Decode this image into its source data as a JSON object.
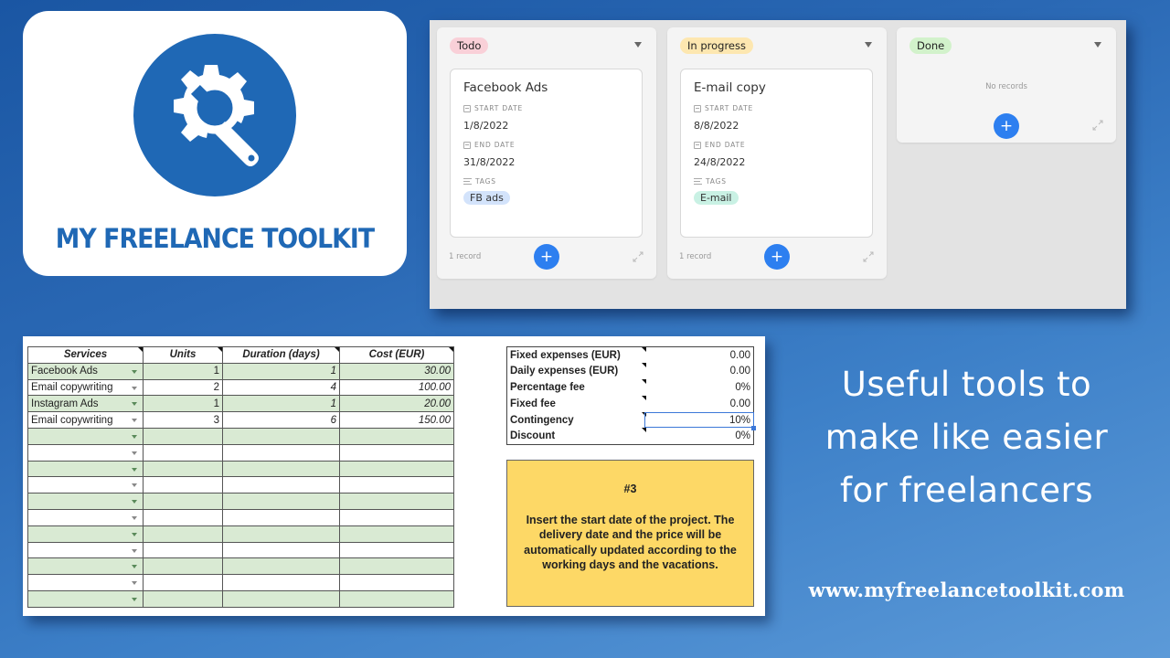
{
  "logo": {
    "title": "MY FREELANCE TOOLKIT",
    "icon": "gear-wrench-icon",
    "color": "#1f68b5"
  },
  "kanban": {
    "columns": [
      {
        "status": "Todo",
        "status_color": "#f9d0d8",
        "card": {
          "title": "Facebook Ads",
          "start_date_label": "START DATE",
          "start_date": "1/8/2022",
          "end_date_label": "END DATE",
          "end_date": "31/8/2022",
          "tags_label": "TAGS",
          "tag": "FB ads",
          "tag_color": "#d3e3fb"
        },
        "record_count": "1 record",
        "add_label": "+"
      },
      {
        "status": "In progress",
        "status_color": "#fde7b0",
        "card": {
          "title": "E-mail copy",
          "start_date_label": "START DATE",
          "start_date": "8/8/2022",
          "end_date_label": "END DATE",
          "end_date": "24/8/2022",
          "tags_label": "TAGS",
          "tag": "E-mail",
          "tag_color": "#c9f1e4"
        },
        "record_count": "1 record",
        "add_label": "+"
      },
      {
        "status": "Done",
        "status_color": "#d2f2cb",
        "empty_text": "No records",
        "add_label": "+"
      }
    ]
  },
  "services_table": {
    "headers": [
      "Services",
      "Units",
      "Duration (days)",
      "Cost (EUR)"
    ],
    "rows": [
      {
        "service": "Facebook Ads",
        "units": "1",
        "duration": "1",
        "cost": "30.00"
      },
      {
        "service": "Email copywriting",
        "units": "2",
        "duration": "4",
        "cost": "100.00"
      },
      {
        "service": "Instagram Ads",
        "units": "1",
        "duration": "1",
        "cost": "20.00"
      },
      {
        "service": "Email copywriting",
        "units": "3",
        "duration": "6",
        "cost": "150.00"
      },
      {
        "service": "",
        "units": "",
        "duration": "",
        "cost": ""
      },
      {
        "service": "",
        "units": "",
        "duration": "",
        "cost": ""
      },
      {
        "service": "",
        "units": "",
        "duration": "",
        "cost": ""
      },
      {
        "service": "",
        "units": "",
        "duration": "",
        "cost": ""
      },
      {
        "service": "",
        "units": "",
        "duration": "",
        "cost": ""
      },
      {
        "service": "",
        "units": "",
        "duration": "",
        "cost": ""
      },
      {
        "service": "",
        "units": "",
        "duration": "",
        "cost": ""
      },
      {
        "service": "",
        "units": "",
        "duration": "",
        "cost": ""
      },
      {
        "service": "",
        "units": "",
        "duration": "",
        "cost": ""
      },
      {
        "service": "",
        "units": "",
        "duration": "",
        "cost": ""
      },
      {
        "service": "",
        "units": "",
        "duration": "",
        "cost": ""
      }
    ]
  },
  "settings_table": {
    "rows": [
      {
        "label": "Fixed expenses (EUR)",
        "value": "0.00"
      },
      {
        "label": "Daily expenses (EUR)",
        "value": "0.00"
      },
      {
        "label": "Percentage fee",
        "value": "0%"
      },
      {
        "label": "Fixed fee",
        "value": "0.00"
      },
      {
        "label": "Contingency",
        "value": "10%"
      },
      {
        "label": "Discount",
        "value": "0%"
      }
    ],
    "selected_row": "Contingency"
  },
  "instructions": {
    "step": "#3",
    "text": "Insert the start date of the project. The delivery date and the price will be automatically updated according to the working days and the vacations."
  },
  "tagline": {
    "lines": [
      "Useful tools to",
      "make like easier",
      "for freelancers"
    ]
  },
  "website": "www.myfreelancetoolkit.com"
}
